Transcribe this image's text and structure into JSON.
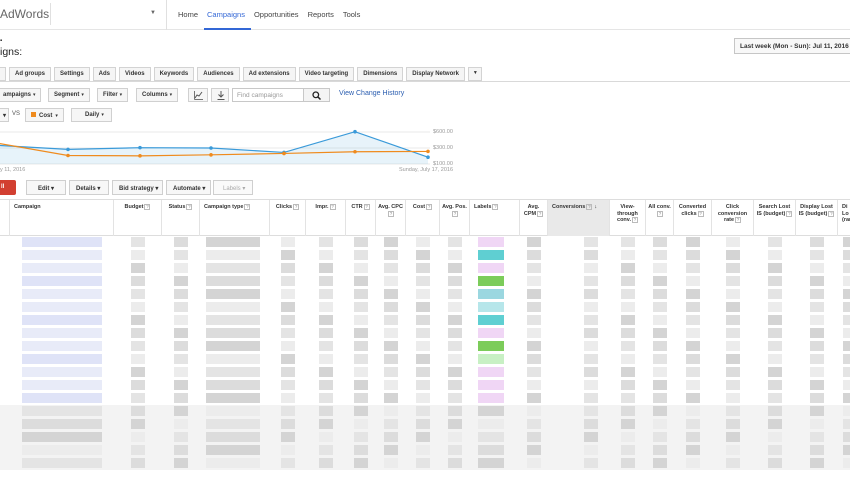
{
  "app": {
    "brand": "AdWords"
  },
  "nav": [
    {
      "label": "Home",
      "active": false
    },
    {
      "label": "Campaigns",
      "active": true
    },
    {
      "label": "Opportunities",
      "active": false
    },
    {
      "label": "Reports",
      "active": false
    },
    {
      "label": "Tools",
      "active": false
    }
  ],
  "page": {
    "title": "igns:",
    "date_range": "Last week (Mon - Sun): Jul 11, 2016 -"
  },
  "tabs": [
    "Ad groups",
    "Settings",
    "Ads",
    "Videos",
    "Keywords",
    "Audiences",
    "Ad extensions",
    "Video targeting",
    "Dimensions",
    "Display Network"
  ],
  "filters": {
    "campaigns": "ampaigns",
    "segment": "Segment",
    "filter": "Filter",
    "columns": "Columns",
    "search_placeholder": "Find campaigns",
    "view_change_history": "View Change History"
  },
  "chart_controls": {
    "vs": "VS",
    "metric2": "Cost",
    "interval": "Daily"
  },
  "chart_data": {
    "type": "line",
    "x_labels": [
      "y 11, 2016",
      "Sunday, July 17, 2016"
    ],
    "y_ticks": [
      "$600.00",
      "$300.00",
      "$100.00"
    ],
    "series": [
      {
        "color": "#3a9ad9",
        "values": [
          0.55,
          0.43,
          0.48,
          0.47,
          0.48,
          0.34,
          0.95,
          0.2
        ]
      },
      {
        "name": "Cost",
        "color": "#ef8b1e",
        "values": [
          0.62,
          0.25,
          0.24,
          0.27,
          0.27,
          0.31,
          0.36,
          0.37
        ]
      }
    ]
  },
  "toolbar": {
    "red": "ll",
    "edit": "Edit",
    "details": "Details",
    "bid_strategy": "Bid strategy",
    "automate": "Automate",
    "labels": "Labels"
  },
  "columns": [
    {
      "label": "Campaign",
      "help": false
    },
    {
      "label": "Budget",
      "help": true
    },
    {
      "label": "Status",
      "help": true
    },
    {
      "label": "Campaign type",
      "help": true
    },
    {
      "label": "Clicks",
      "help": true
    },
    {
      "label": "Impr.",
      "help": true
    },
    {
      "label": "CTR",
      "help": true
    },
    {
      "label": "Avg. CPC",
      "help": true
    },
    {
      "label": "Cost",
      "help": true
    },
    {
      "label": "Avg. Pos.",
      "help": true
    },
    {
      "label": "Labels",
      "help": true
    },
    {
      "label": "Avg. CPM",
      "help": true
    },
    {
      "label": "Conversions",
      "help": true
    },
    {
      "label": "View-through conv.",
      "help": true
    },
    {
      "label": "All conv.",
      "help": true
    },
    {
      "label": "Converted clicks",
      "help": true
    },
    {
      "label": "Click conversion rate",
      "help": true
    },
    {
      "label": "Search Lost IS (budget)",
      "help": true
    },
    {
      "label": "Display Lost IS (budget)",
      "help": true
    },
    {
      "label": "Di Lo (ran",
      "help": false
    }
  ],
  "help_glyph": "?",
  "sort_glyph": "↓",
  "search_icon": "search-icon",
  "colors": {
    "accent": "#3367d6",
    "link": "#2a5db0",
    "red_button": "#d23f31",
    "line_blue": "#3a9ad9",
    "line_orange": "#ef8b1e"
  }
}
